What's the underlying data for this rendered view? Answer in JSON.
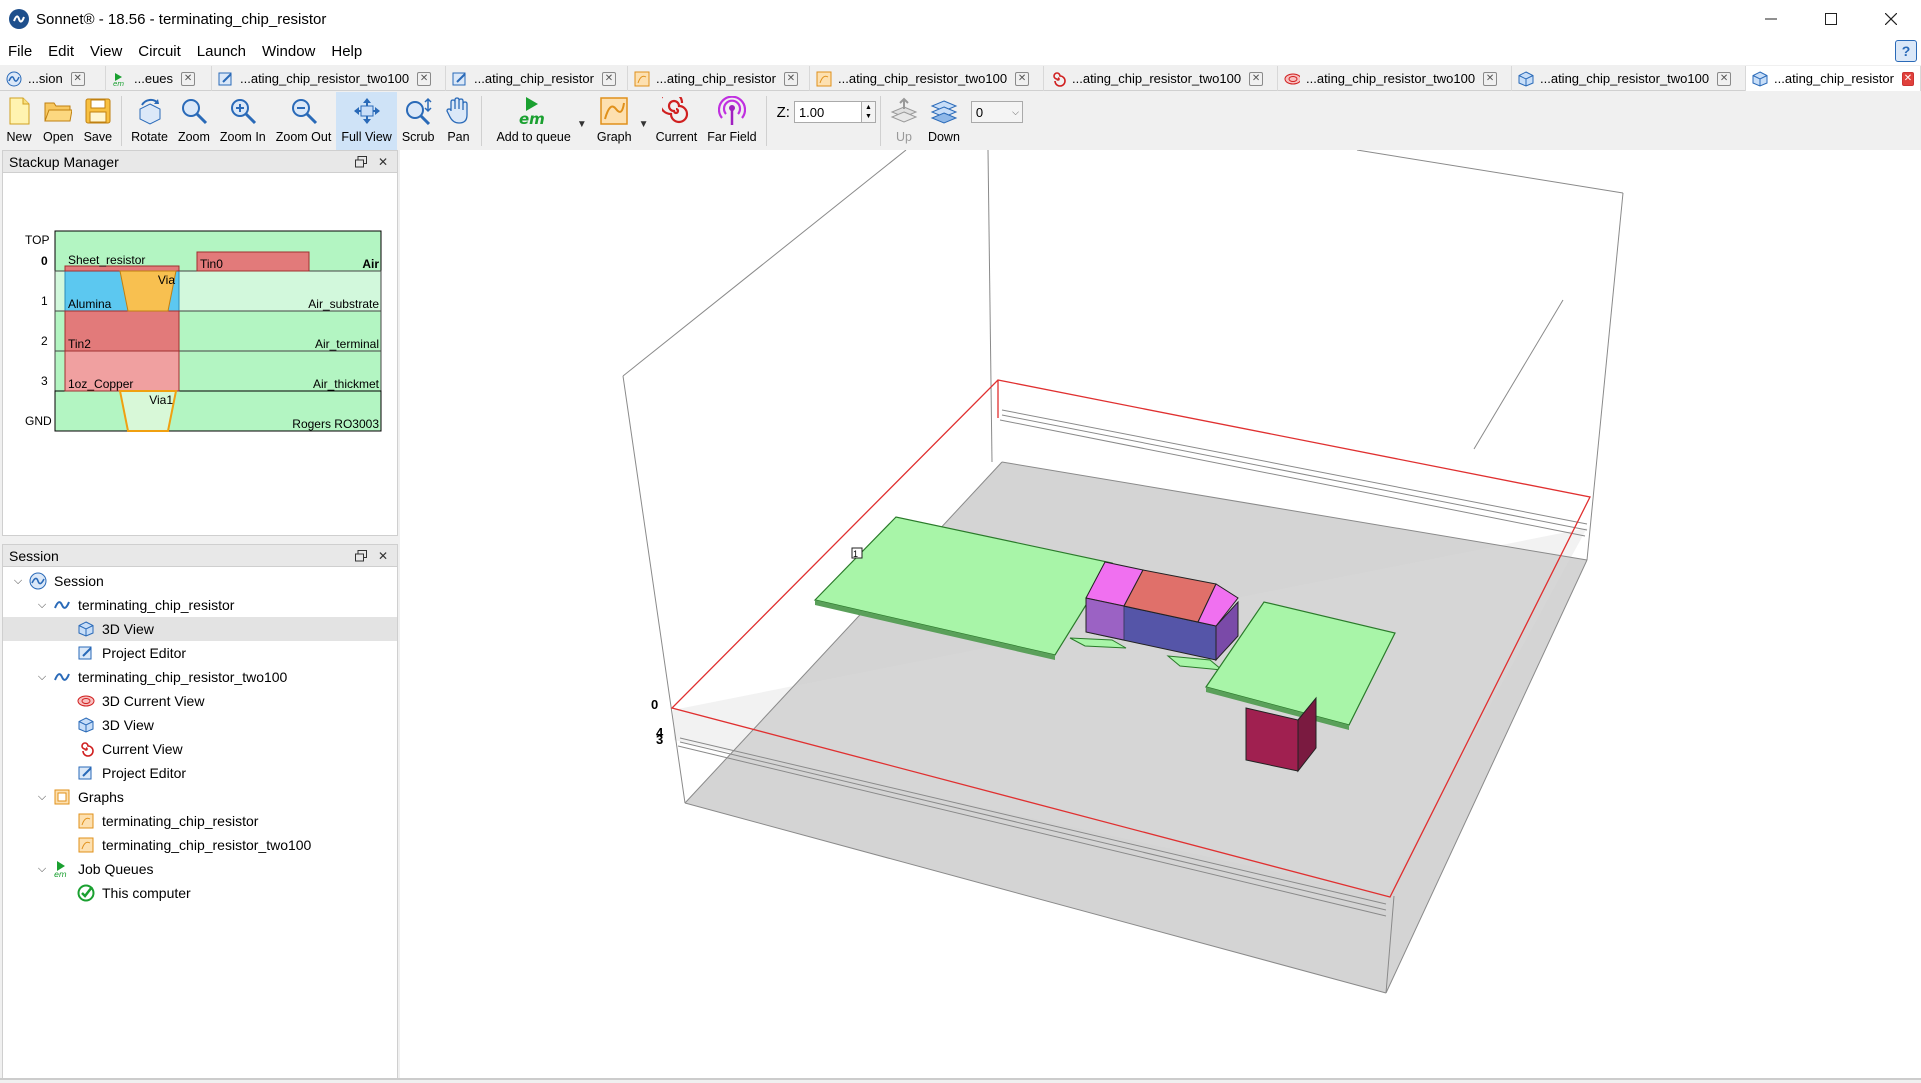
{
  "window": {
    "title": "Sonnet® - 18.56 - terminating_chip_resistor"
  },
  "menu": [
    "File",
    "Edit",
    "View",
    "Circuit",
    "Launch",
    "Window",
    "Help"
  ],
  "tabs": [
    {
      "label": "...sion",
      "icon": "session-icon",
      "active": false
    },
    {
      "label": "...eues",
      "icon": "em-queue-icon",
      "active": false
    },
    {
      "label": "...ating_chip_resistor_two100",
      "icon": "project-editor-icon",
      "active": false
    },
    {
      "label": "...ating_chip_resistor",
      "icon": "project-editor-icon",
      "active": false
    },
    {
      "label": "...ating_chip_resistor",
      "icon": "graph-icon",
      "active": false
    },
    {
      "label": "...ating_chip_resistor_two100",
      "icon": "graph-icon",
      "active": false
    },
    {
      "label": "...ating_chip_resistor_two100",
      "icon": "current-view-icon",
      "active": false
    },
    {
      "label": "...ating_chip_resistor_two100",
      "icon": "3d-current-view-icon",
      "active": false
    },
    {
      "label": "...ating_chip_resistor_two100",
      "icon": "3d-view-icon",
      "active": false
    },
    {
      "label": "...ating_chip_resistor",
      "icon": "3d-view-icon",
      "active": true
    }
  ],
  "toolbar": {
    "new": "New",
    "open": "Open",
    "save": "Save",
    "rotate": "Rotate",
    "zoom": "Zoom",
    "zoom_in": "Zoom In",
    "zoom_out": "Zoom Out",
    "full_view": "Full View",
    "scrub": "Scrub",
    "pan": "Pan",
    "add_to_queue": "Add to queue",
    "graph": "Graph",
    "current": "Current",
    "far_field": "Far Field",
    "z_label": "Z:",
    "z_value": "1.00",
    "up": "Up",
    "down": "Down",
    "layer_value": "0",
    "em_text": "em"
  },
  "stackup": {
    "title": "Stackup Manager",
    "levels": [
      "TOP",
      "0",
      "1",
      "2",
      "3",
      "GND"
    ],
    "labels": {
      "sheet_resistor": "Sheet_resistor",
      "tin0": "Tin0",
      "air": "Air",
      "via": "Via",
      "alumina": "Alumina",
      "air_substrate": "Air_substrate",
      "tin2": "Tin2",
      "air_terminal": "Air_terminal",
      "copper": "1oz_Copper",
      "air_thickmet": "Air_thickmet",
      "via1": "Via1",
      "rogers": "Rogers RO3003"
    },
    "colors": {
      "dielectric": "#b3f5c2",
      "alumina": "#5cc8f0",
      "tin": "#e27a7a",
      "copper": "#f0a0a0",
      "via": "#f8c050"
    }
  },
  "session": {
    "title": "Session",
    "root": "Session",
    "project1": "terminating_chip_resistor",
    "p1_3d_view": "3D View",
    "p1_project_editor": "Project Editor",
    "project2": "terminating_chip_resistor_two100",
    "p2_3d_current_view": "3D Current View",
    "p2_3d_view": "3D View",
    "p2_current_view": "Current View",
    "p2_project_editor": "Project Editor",
    "graphs": "Graphs",
    "graph1": "terminating_chip_resistor",
    "graph2": "terminating_chip_resistor_two100",
    "job_queues": "Job Queues",
    "this_computer": "This computer"
  },
  "view3d": {
    "axis_label_0": "0",
    "axis_label_4": "4",
    "axis_label_3": "3",
    "port_label": "1",
    "colors": {
      "metal": "#a8f5a8",
      "resistor_body": "#e0706a",
      "terminal": "#f070f0",
      "substrate": "#5050a8",
      "via": "#a02050",
      "box_red": "#e03030",
      "floor": "#d8d8d8"
    }
  }
}
